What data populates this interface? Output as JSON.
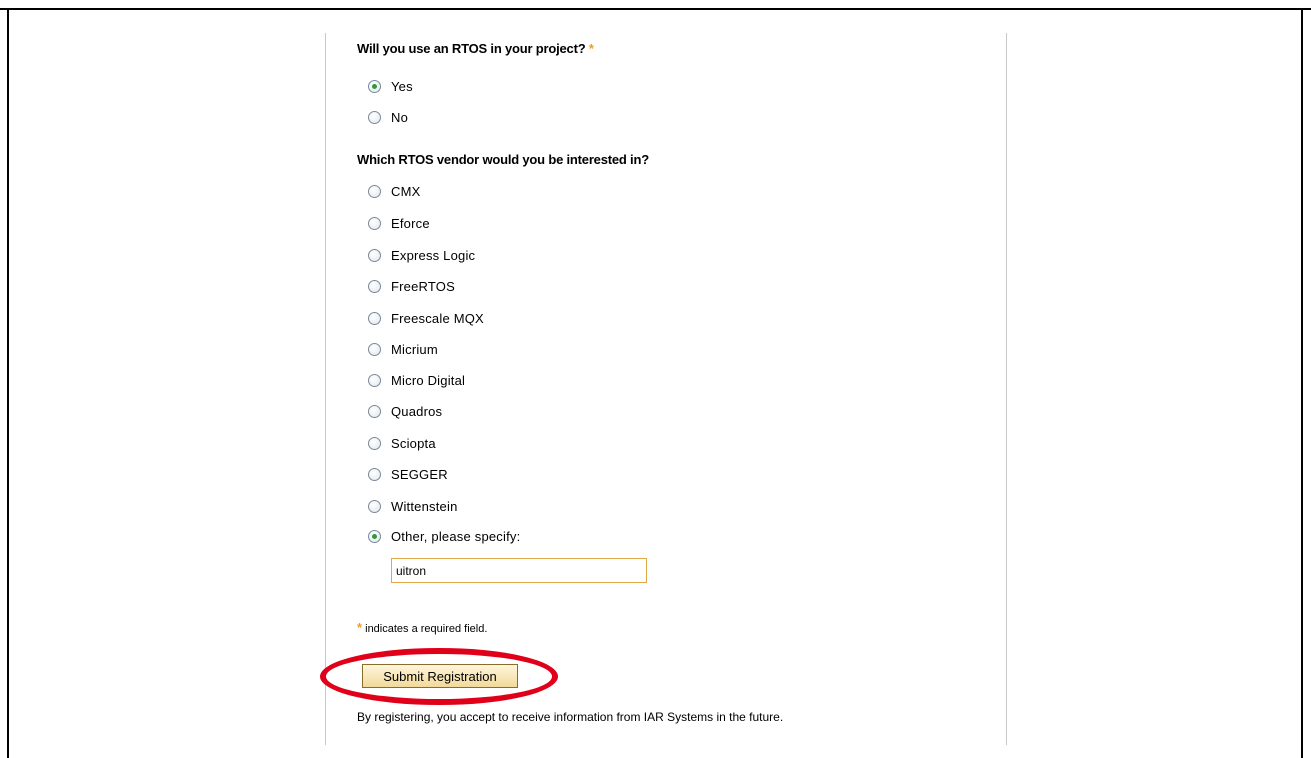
{
  "rtos_question": {
    "text": "Will you use an RTOS in your project?",
    "required_marker": "*",
    "options": [
      {
        "label": "Yes",
        "checked": true
      },
      {
        "label": "No",
        "checked": false
      }
    ]
  },
  "vendor_question": {
    "text": "Which RTOS vendor would you be interested in?",
    "options": [
      {
        "label": "CMX",
        "checked": false
      },
      {
        "label": "Eforce",
        "checked": false
      },
      {
        "label": "Express Logic",
        "checked": false
      },
      {
        "label": "FreeRTOS",
        "checked": false
      },
      {
        "label": "Freescale MQX",
        "checked": false
      },
      {
        "label": "Micrium",
        "checked": false
      },
      {
        "label": "Micro Digital",
        "checked": false
      },
      {
        "label": "Quadros",
        "checked": false
      },
      {
        "label": "Sciopta",
        "checked": false
      },
      {
        "label": "SEGGER",
        "checked": false
      },
      {
        "label": "Wittenstein",
        "checked": false
      },
      {
        "label": "Other, please specify:",
        "checked": true
      }
    ],
    "other_value": "uitron"
  },
  "required_note": {
    "marker": "*",
    "text": "indicates a required field."
  },
  "submit": {
    "label": "Submit Registration"
  },
  "footer": {
    "text": "By registering, you accept to receive information from IAR Systems in the future."
  },
  "colors": {
    "required_star": "#f39a1e",
    "highlight_ring": "#e0001a",
    "radio_dot": "#2f9a3a"
  }
}
